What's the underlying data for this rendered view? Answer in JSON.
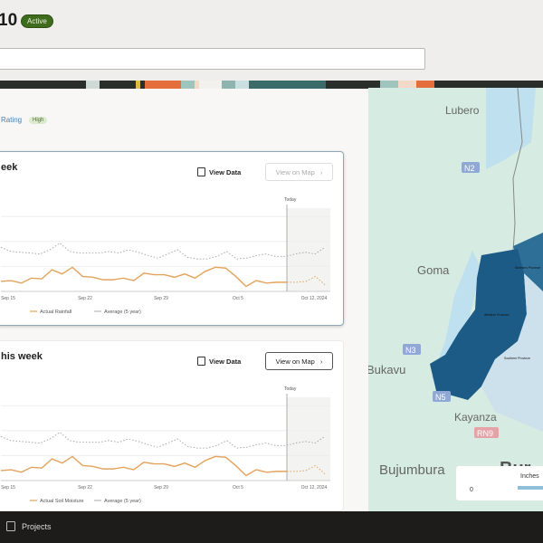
{
  "header": {
    "title": "10",
    "status": "Active"
  },
  "rating": {
    "label": "Rating",
    "value": "High"
  },
  "cards": [
    {
      "title": "eek",
      "view_data": "View Data",
      "view_on_map": "View on Map"
    },
    {
      "title": "his week",
      "view_data": "View Data",
      "view_on_map": "View on Map"
    }
  ],
  "chart_data": [
    {
      "type": "line",
      "today_label": "Today",
      "x_ticks": [
        "Sep 15",
        "Sep 22",
        "Sep 29",
        "Oct 5",
        "Oct 12, 2024"
      ],
      "series": [
        {
          "name": "Actual Rainfall",
          "color": "#e3a35c",
          "values": [
            12,
            13,
            10,
            16,
            15,
            26,
            21,
            29,
            18,
            17,
            14,
            14,
            16,
            13,
            22,
            20,
            20,
            17,
            21,
            16,
            24,
            29,
            28,
            18,
            6,
            13,
            10,
            11,
            11
          ],
          "forecast": [
            11,
            12,
            18,
            8
          ]
        },
        {
          "name": "Average (5 year)",
          "color": "#aaaaaa",
          "values": [
            53,
            48,
            47,
            46,
            45,
            50,
            58,
            48,
            46,
            46,
            46,
            48,
            46,
            50,
            47,
            43,
            40,
            45,
            50,
            41,
            39,
            39,
            42,
            48,
            39,
            40,
            43,
            45,
            42,
            42,
            45,
            47,
            45,
            53
          ]
        }
      ]
    },
    {
      "type": "line",
      "today_label": "Today",
      "x_ticks": [
        "Sep 15",
        "Sep 22",
        "Sep 29",
        "Oct 5",
        "Oct 12, 2024"
      ],
      "series": [
        {
          "name": "Actual Soil Moisture",
          "color": "#e3a35c",
          "values": [
            12,
            13,
            10,
            16,
            15,
            26,
            21,
            29,
            18,
            17,
            14,
            14,
            16,
            13,
            22,
            20,
            20,
            17,
            21,
            16,
            24,
            29,
            28,
            18,
            6,
            13,
            10,
            11,
            11
          ],
          "forecast": [
            11,
            12,
            18,
            8
          ]
        },
        {
          "name": "Average (5 year)",
          "color": "#aaaaaa",
          "values": [
            53,
            48,
            47,
            46,
            45,
            50,
            58,
            48,
            46,
            46,
            46,
            48,
            46,
            50,
            47,
            43,
            40,
            45,
            50,
            41,
            39,
            39,
            42,
            48,
            39,
            40,
            43,
            45,
            42,
            42,
            45,
            47,
            45,
            53
          ]
        }
      ]
    }
  ],
  "map": {
    "places": [
      "Lubero",
      "Goma",
      "Bukavu",
      "Kayanza",
      "Bujumbura",
      "Bur"
    ],
    "roads": [
      "N2",
      "N3",
      "N5",
      "RN9"
    ],
    "regions": [
      "Western Province",
      "Southern Province",
      "Northern Province"
    ],
    "legend": {
      "title": "Inches",
      "min": "0"
    }
  },
  "bottom": {
    "projects": "Projects"
  }
}
